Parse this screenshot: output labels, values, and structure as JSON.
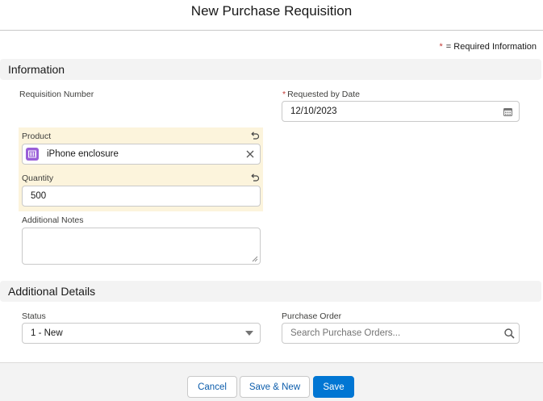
{
  "modal": {
    "title": "New Purchase Requisition",
    "required_legend": {
      "star": "*",
      "text": "= Required Information"
    }
  },
  "sections": {
    "information": "Information",
    "additional_details": "Additional Details"
  },
  "fields": {
    "requisition_number": {
      "label": "Requisition Number"
    },
    "requested_by_date": {
      "required_mark": "*",
      "label": "Requested by Date",
      "value": "12/10/2023"
    },
    "product": {
      "label": "Product",
      "value": "iPhone enclosure"
    },
    "quantity": {
      "label": "Quantity",
      "value": "500"
    },
    "additional_notes": {
      "label": "Additional Notes",
      "value": ""
    },
    "status": {
      "label": "Status",
      "value": "1 - New"
    },
    "purchase_order": {
      "label": "Purchase Order",
      "placeholder": "Search Purchase Orders..."
    }
  },
  "footer": {
    "cancel_label": "Cancel",
    "save_new_label": "Save & New",
    "save_label": "Save"
  },
  "colors": {
    "brand": "#0176d3",
    "required": "#c23934",
    "changed_highlight": "#fcf4dc",
    "product_badge": "#9a5fd8"
  }
}
